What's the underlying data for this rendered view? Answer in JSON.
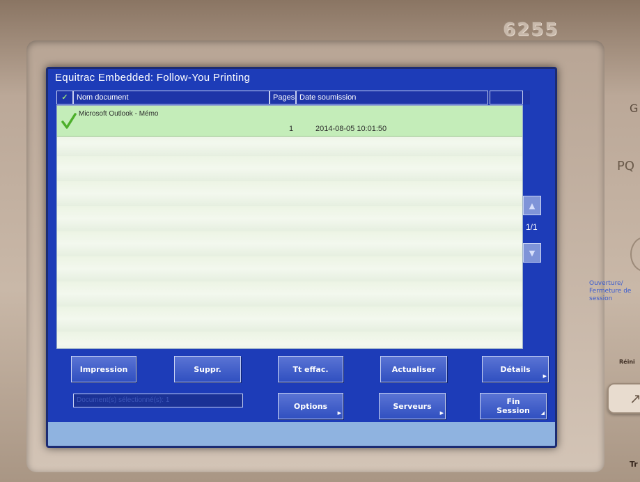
{
  "device": {
    "model_number": "6255",
    "side_labels": {
      "pq": "PQ",
      "login_logout": "Ouverture/ Fermeture de session",
      "reinit": "Réini",
      "tr": "Tr",
      "g": "G"
    }
  },
  "window": {
    "title": "Equitrac Embedded: Follow-You Printing"
  },
  "table": {
    "check_header": "✓",
    "columns": {
      "name": "Nom document",
      "pages": "Pages",
      "date": "Date soumission",
      "extra": ""
    },
    "rows": [
      {
        "selected": true,
        "name": "Microsoft Outlook - Mémo",
        "pages": "1",
        "date": "2014-08-05 10:01:50"
      }
    ]
  },
  "pagination": {
    "indicator": "1/1",
    "up_icon": "triangle-up-icon",
    "down_icon": "triangle-down-icon"
  },
  "buttons": {
    "impression": "Impression",
    "suppr": "Suppr.",
    "tt_effac": "Tt effac.",
    "actualiser": "Actualiser",
    "details": "Détails",
    "options": "Options",
    "serveurs": "Serveurs",
    "fin_session": "Fin Session"
  },
  "status": {
    "text": "Document(s) sélectionné(s): 1"
  },
  "colors": {
    "screen_bg": "#1d3cb8",
    "selected_row": "#c4edb9",
    "button": "#3050c0",
    "check": "#4caf2a"
  }
}
